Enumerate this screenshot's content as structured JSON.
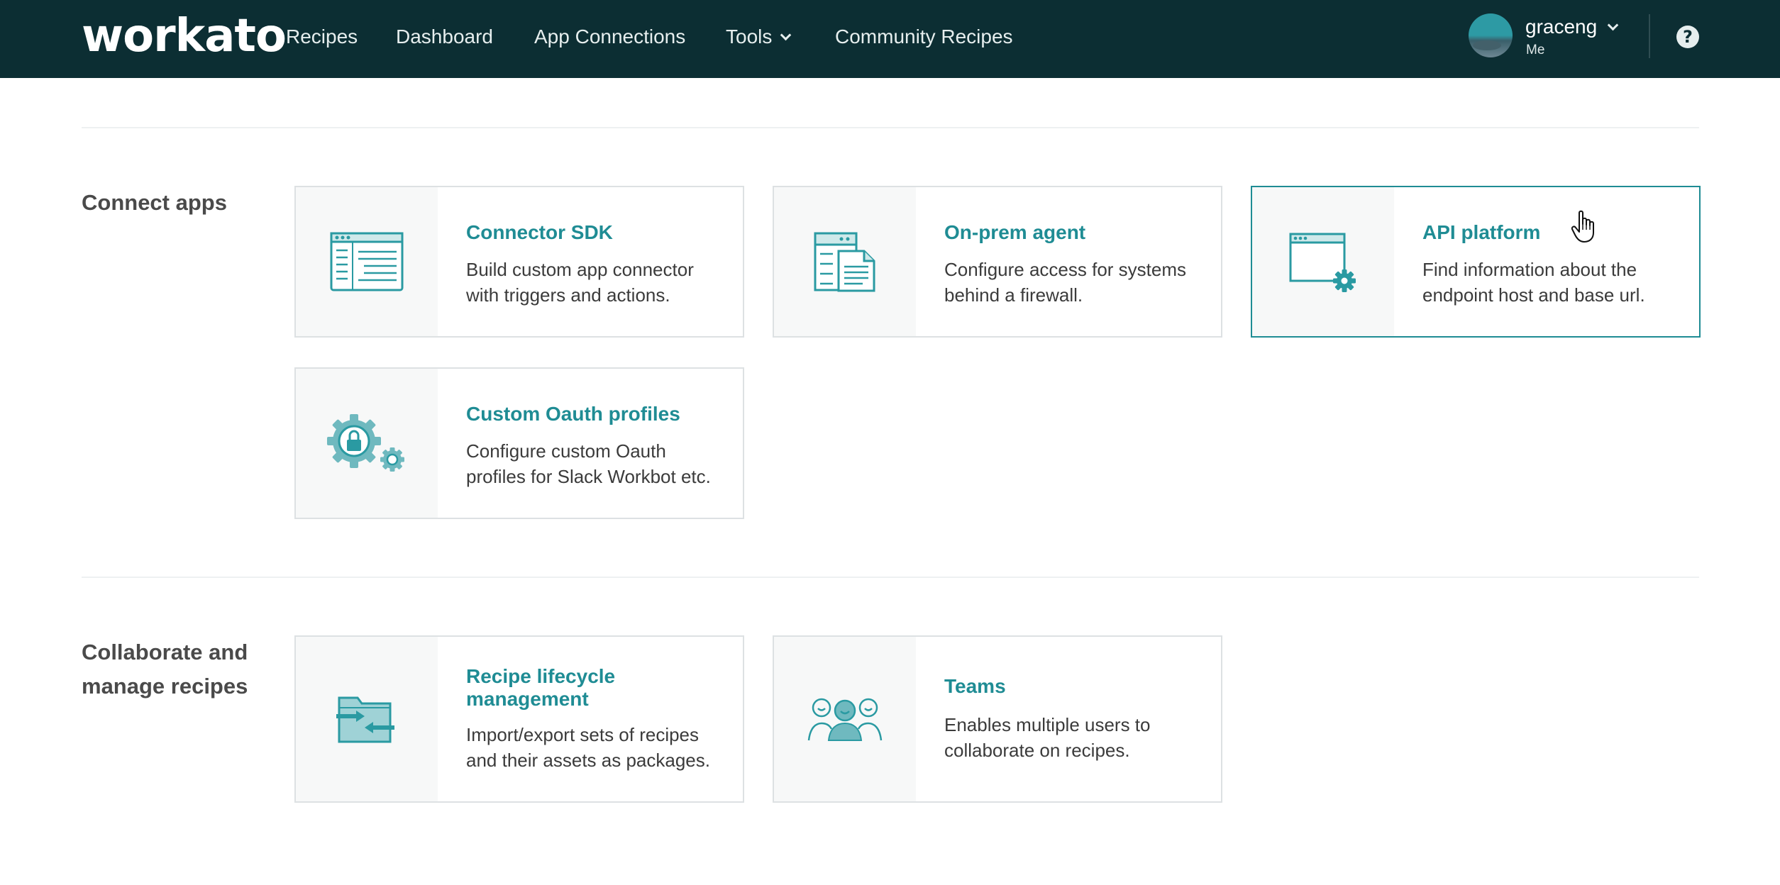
{
  "nav": {
    "logo": "workato",
    "items": [
      {
        "label": "Recipes"
      },
      {
        "label": "Dashboard"
      },
      {
        "label": "App Connections"
      },
      {
        "label": "Tools"
      },
      {
        "label": "Community Recipes"
      }
    ],
    "user": {
      "name": "graceng",
      "sub": "Me"
    },
    "help": "?"
  },
  "sections": [
    {
      "title": "Connect apps",
      "cards": [
        {
          "title": "Connector SDK",
          "desc": "Build custom app connector with triggers and actions.",
          "icon": "connector-sdk-icon"
        },
        {
          "title": "On-prem agent",
          "desc": "Configure access for systems behind a firewall.",
          "icon": "on-prem-agent-icon"
        },
        {
          "title": "API platform",
          "desc": "Find information about the endpoint host and base url.",
          "icon": "api-platform-icon"
        },
        {
          "title": "Custom Oauth profiles",
          "desc": "Configure custom Oauth profiles for Slack Workbot etc.",
          "icon": "oauth-gear-lock-icon"
        }
      ]
    },
    {
      "title": "Collaborate and manage recipes",
      "cards": [
        {
          "title": "Recipe lifecycle management",
          "desc": "Import/export sets of recipes and their assets as packages.",
          "icon": "folder-exchange-icon"
        },
        {
          "title": "Teams",
          "desc": "Enables multiple users to collaborate on recipes.",
          "icon": "team-users-icon"
        }
      ]
    }
  ],
  "colors": {
    "nav_bg": "#0c2e33",
    "accent": "#1f8c94"
  }
}
